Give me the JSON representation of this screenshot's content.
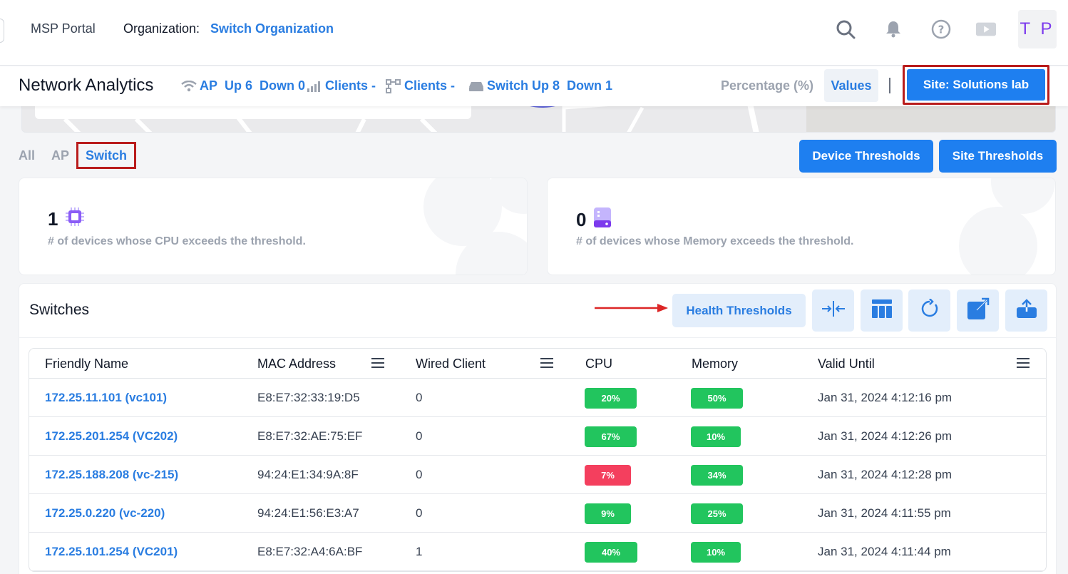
{
  "topbar": {
    "portal_label": "MSP Portal",
    "org_label": "Organization:",
    "org_value": "Switch Organization",
    "icons": [
      "search-icon",
      "bell-icon",
      "help-icon",
      "video-icon"
    ],
    "avatar_initials": "T P"
  },
  "header": {
    "title": "Network Analytics",
    "ap_label": "AP",
    "ap_up": "Up 6",
    "ap_down": "Down 0",
    "clients_wireless": "Clients -",
    "clients_wired": "Clients -",
    "switch_up": "Switch Up 8",
    "switch_down": "Down 1",
    "percentage_label": "Percentage (%)",
    "values_label": "Values",
    "site_button": "Site: Solutions lab"
  },
  "filters": {
    "all": "All",
    "ap": "AP",
    "switch": "Switch",
    "device_thresholds": "Device Thresholds",
    "site_thresholds": "Site Thresholds"
  },
  "cards": {
    "cpu_count": "1",
    "cpu_desc": "# of devices whose CPU exceeds the threshold.",
    "memory_count": "0",
    "memory_desc": "# of devices whose Memory exceeds the threshold."
  },
  "switches": {
    "title": "Switches",
    "health_thresholds": "Health Thresholds",
    "columns": {
      "friendly_name": "Friendly Name",
      "mac": "MAC Address",
      "wired_client": "Wired Client",
      "cpu": "CPU",
      "memory": "Memory",
      "valid_until": "Valid Until"
    },
    "rows": [
      {
        "name": "172.25.11.101 (vc101)",
        "mac": "E8:E7:32:33:19:D5",
        "wired": "0",
        "cpu": "20%",
        "memory": "50%",
        "valid": "Jan 31, 2024 4:12:16 pm"
      },
      {
        "name": "172.25.201.254 (VC202)",
        "mac": "E8:E7:32:AE:75:EF",
        "wired": "0",
        "cpu": "67%",
        "memory": "10%",
        "valid": "Jan 31, 2024 4:12:26 pm"
      },
      {
        "name": "172.25.188.208 (vc-215)",
        "mac": "94:24:E1:34:9A:8F",
        "wired": "0",
        "cpu": "7%",
        "memory": "34%",
        "valid": "Jan 31, 2024 4:12:28 pm"
      },
      {
        "name": "172.25.0.220 (vc-220)",
        "mac": "94:24:E1:56:E3:A7",
        "wired": "0",
        "cpu": "9%",
        "memory": "25%",
        "valid": "Jan 31, 2024 4:11:55 pm"
      },
      {
        "name": "172.25.101.254 (VC201)",
        "mac": "E8:E7:32:A4:6A:BF",
        "wired": "1",
        "cpu": "40%",
        "memory": "10%",
        "valid": "Jan 31, 2024 4:11:44 pm"
      }
    ]
  },
  "colors": {
    "accent": "#2a7de1",
    "primary_button": "#1e7ff0",
    "ok_badge": "#22c55e",
    "alert_badge": "#f43f5e",
    "highlight_border": "#b91c1c",
    "purple": "#7c3aed"
  }
}
